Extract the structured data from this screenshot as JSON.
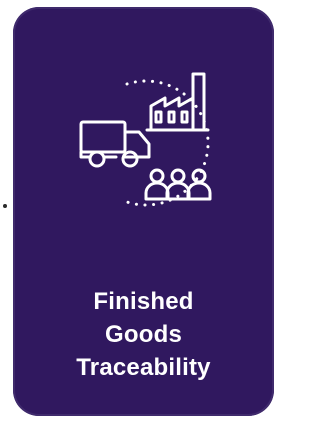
{
  "card": {
    "title_lines": [
      "Finished",
      "Goods",
      "Traceability"
    ],
    "icon": "supply-chain-traceability-icon"
  },
  "colors": {
    "card_background": "#30185f",
    "card_border": "#3f2a6c",
    "text": "#ffffff",
    "icon_stroke": "#ffffff",
    "stray_dot": "#2b2b2b"
  }
}
